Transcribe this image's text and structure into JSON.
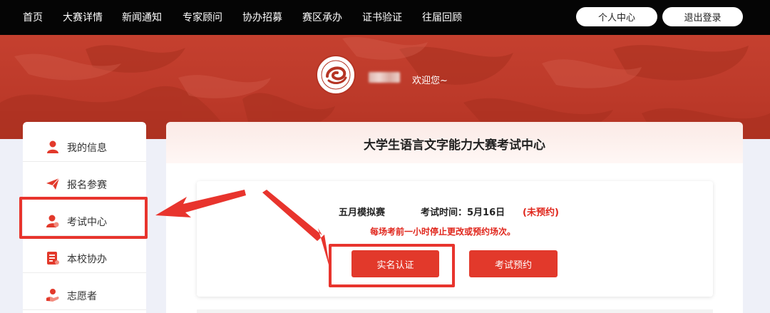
{
  "nav": {
    "items": [
      "首页",
      "大赛详情",
      "新闻通知",
      "专家顾问",
      "协办招募",
      "赛区承办",
      "证书验证",
      "往届回顾"
    ],
    "profile_button": "个人中心",
    "logout_button": "退出登录"
  },
  "banner": {
    "welcome": "欢迎您~"
  },
  "sidebar": {
    "items": [
      {
        "label": "我的信息",
        "icon": "user-icon"
      },
      {
        "label": "报名参赛",
        "icon": "paper-plane-icon"
      },
      {
        "label": "考试中心",
        "icon": "user-exam-icon"
      },
      {
        "label": "本校协办",
        "icon": "document-list-icon"
      },
      {
        "label": "志愿者",
        "icon": "helping-hand-icon"
      }
    ],
    "highlighted": "考试中心"
  },
  "main": {
    "title": "大学生语言文字能力大赛考试中心",
    "exam": {
      "name": "五月模拟赛",
      "time_label": "考试时间：5月16日",
      "status": "(未预约)",
      "note": "每场考前一小时停止更改或预约场次。",
      "verify_button": "实名认证",
      "book_button": "考试预约"
    }
  },
  "colors": {
    "accent": "#e2392b",
    "banner": "#c5402f",
    "nav_bg": "#050505",
    "annotation": "#e8342d"
  }
}
